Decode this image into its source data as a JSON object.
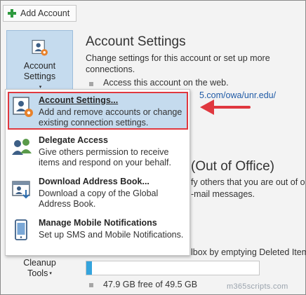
{
  "toolbar": {
    "add_account_label": "Add Account"
  },
  "account_button": {
    "line1": "Account",
    "line2": "Settings",
    "caret": "▾"
  },
  "cleanup_button": {
    "line1": "Cleanup",
    "line2": "Tools",
    "caret": "▾"
  },
  "account_settings_section": {
    "title": "Account Settings",
    "description": "Change settings for this account or set up more connections.",
    "bullet_text": "Access this account on the web.",
    "link_fragment": "5.com/owa/unr.edu/"
  },
  "ooo_section": {
    "title_fragment": "(Out of Office)",
    "desc_line1": "fy others that you are out of o",
    "desc_line2": "-mail messages."
  },
  "mailbox_section": {
    "desc_fragment": "lbox by emptying Deleted Items",
    "storage_text": "47.9 GB free of 49.5 GB",
    "used_fraction": 0.032
  },
  "menu": {
    "items": [
      {
        "title": "Account Settings...",
        "subtitle": "Add and remove accounts or change existing connection settings."
      },
      {
        "title": "Delegate Access",
        "subtitle": "Give others permission to receive items and respond on your behalf."
      },
      {
        "title": "Download Address Book...",
        "subtitle": "Download a copy of the Global Address Book."
      },
      {
        "title": "Manage Mobile Notifications",
        "subtitle": "Set up SMS and Mobile Notifications."
      }
    ]
  },
  "watermark": "m365scripts.com",
  "colors": {
    "highlight": "#c5dbee",
    "highlight_border": "#e0383f",
    "arrow": "#e0383f",
    "progress_fill": "#34a4dd"
  }
}
